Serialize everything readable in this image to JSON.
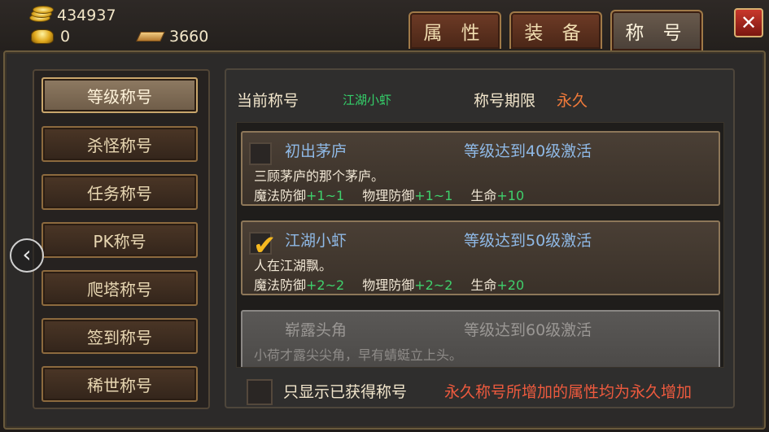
{
  "currency": {
    "silver": "434937",
    "gold": "0",
    "vouchers": "3660"
  },
  "tabs": [
    {
      "label": "属 性",
      "active": false
    },
    {
      "label": "装 备",
      "active": false
    },
    {
      "label": "称 号",
      "active": true
    }
  ],
  "close_label": "✕",
  "categories": [
    {
      "label": "等级称号",
      "active": true
    },
    {
      "label": "杀怪称号",
      "active": false
    },
    {
      "label": "任务称号",
      "active": false
    },
    {
      "label": "PK称号",
      "active": false
    },
    {
      "label": "爬塔称号",
      "active": false
    },
    {
      "label": "签到称号",
      "active": false
    },
    {
      "label": "稀世称号",
      "active": false
    }
  ],
  "nav_prev": "‹",
  "current": {
    "label": "当前称号",
    "value": "江湖小虾",
    "period_label": "称号期限",
    "period_value": "永久"
  },
  "titles": [
    {
      "name": "初出茅庐",
      "condition": "等级达到40级激活",
      "desc": "三顾茅庐的那个茅庐。",
      "stats": [
        {
          "name": "魔法防御",
          "value": "+1~1"
        },
        {
          "name": "物理防御",
          "value": "+1~1"
        },
        {
          "name": "生命",
          "value": "+10"
        }
      ],
      "checked": false,
      "locked": false
    },
    {
      "name": "江湖小虾",
      "condition": "等级达到50级激活",
      "desc": "人在江湖飘。",
      "stats": [
        {
          "name": "魔法防御",
          "value": "+2~2"
        },
        {
          "name": "物理防御",
          "value": "+2~2"
        },
        {
          "name": "生命",
          "value": "+20"
        }
      ],
      "checked": true,
      "locked": false
    },
    {
      "name": "崭露头角",
      "condition": "等级达到60级激活",
      "desc": "小荷才露尖尖角，早有蜻蜓立上头。",
      "stats": [],
      "checked": false,
      "locked": true
    }
  ],
  "footer": {
    "filter_label": "只显示已获得称号",
    "note": "永久称号所增加的属性均为永久增加"
  }
}
